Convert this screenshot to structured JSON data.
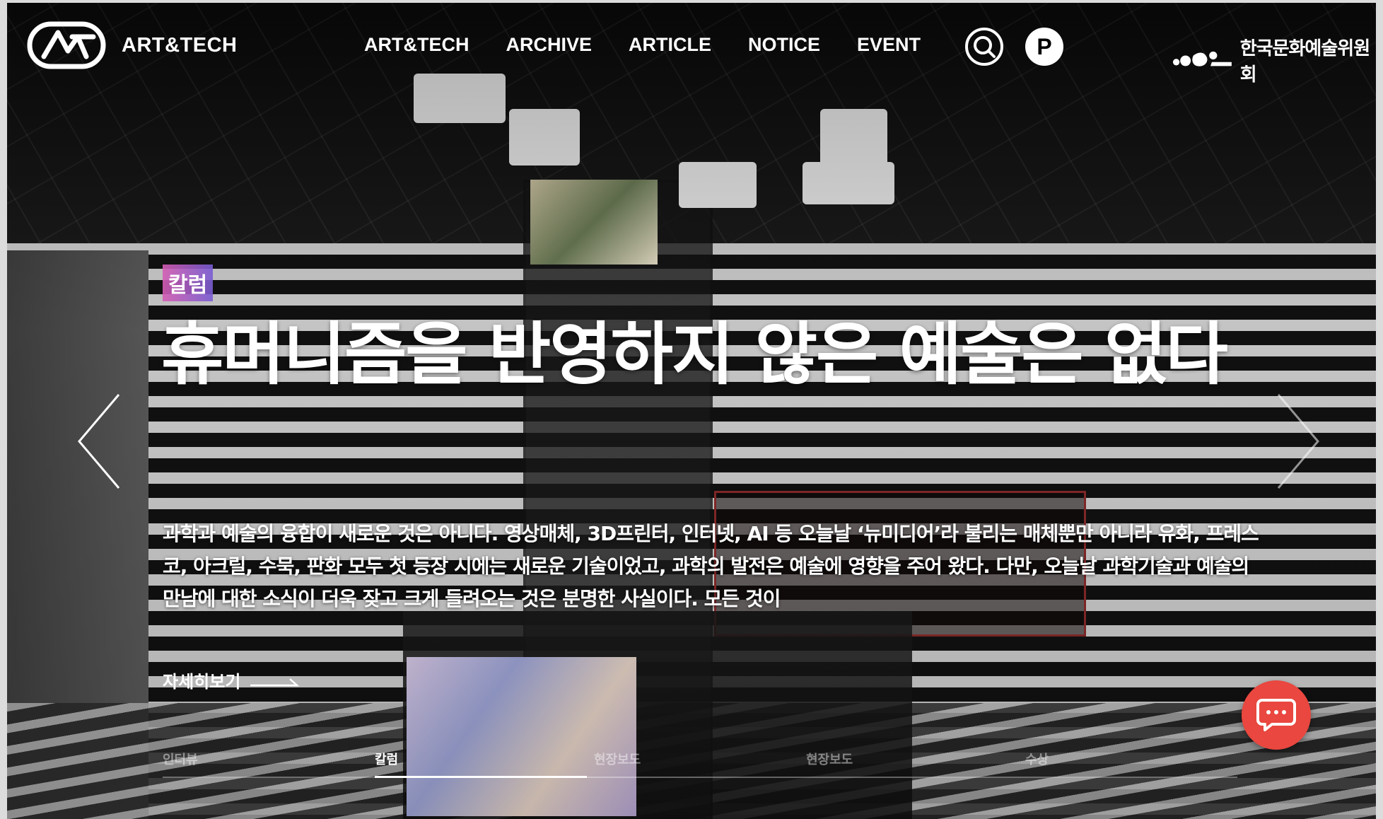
{
  "header": {
    "brand": "ART&TECH",
    "nav": [
      "ART&TECH",
      "ARCHIVE",
      "ARTICLE",
      "NOTICE",
      "EVENT"
    ],
    "parking_label": "P",
    "org_name": "한국문화예술위원회"
  },
  "hero": {
    "category": "칼럼",
    "title": "휴머니즘을 반영하지 않은 예술은 없다",
    "excerpt": "과학과 예술의 융합이 새로운 것은 아니다. 영상매체, 3D프린터, 인터넷, AI 등 오늘날 ‘뉴미디어’라 불리는 매체뿐만 아니라 유화, 프레스코, 아크릴, 수묵, 판화 모두 첫 등장 시에는 새로운 기술이었고, 과학의 발전은 예술에 영향을 주어 왔다. 다만, 오늘날 과학기술과 예술의 만남에 대한 소식이 더욱 잦고 크게 들려오는 것은 분명한 사실이다. 모든 것이",
    "more_label": "자세히보기"
  },
  "tabs": {
    "items": [
      "인터뷰",
      "칼럼",
      "현장보도",
      "현장보도",
      "수상"
    ],
    "active_index": 1
  },
  "colors": {
    "chat_button": "#e9473f",
    "badge_gradient_start": "#d55cb4",
    "badge_gradient_end": "#785cd2"
  },
  "icons": {
    "search": "search-icon",
    "chat": "chat-icon",
    "prev": "chevron-left-icon",
    "next": "chevron-right-icon"
  }
}
